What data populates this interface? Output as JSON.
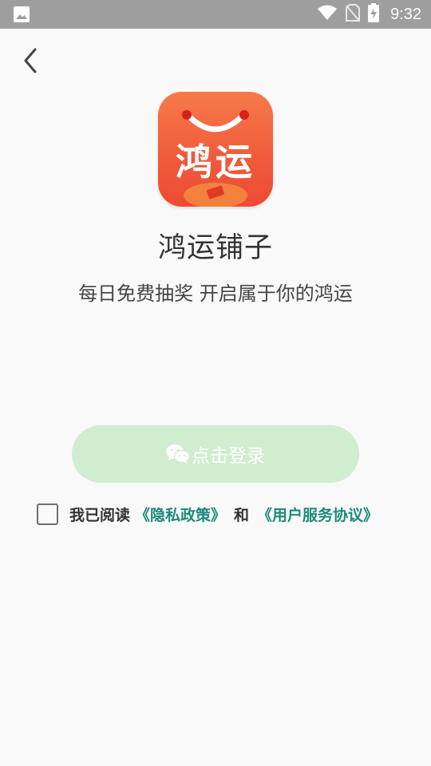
{
  "status_bar": {
    "time": "9:32",
    "icons": [
      "image-icon",
      "wifi-icon",
      "no-sim-icon",
      "battery-charging-icon"
    ]
  },
  "nav": {
    "back_icon": "chevron-left-icon"
  },
  "app": {
    "logo_text": "鸿运",
    "name": "鸿运铺子",
    "slogan": "每日免费抽奖 开启属于你的鸿运"
  },
  "login": {
    "button_label": "点击登录",
    "button_icon": "wechat-icon"
  },
  "agreement": {
    "checked": false,
    "prefix": "我已阅读",
    "privacy_link": "《隐私政策》",
    "conjunction": "和",
    "terms_link": "《用户服务协议》"
  },
  "colors": {
    "accent": "#1b8a7a",
    "login_button": "#d0edcf",
    "logo": "#f05a3a",
    "status_bar": "#9e9e9e"
  }
}
